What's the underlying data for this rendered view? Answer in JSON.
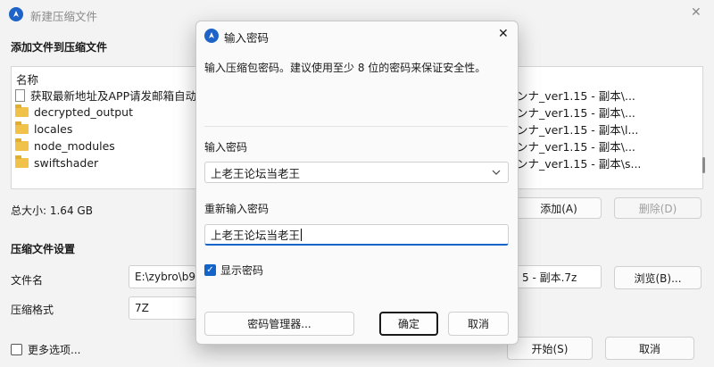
{
  "window": {
    "title": "新建压缩文件",
    "close_glyph": "✕",
    "section_add": "添加文件到压缩文件",
    "list": {
      "header": "名称",
      "items": [
        {
          "name": "获取最新地址及APP请发邮箱自动",
          "type": "file-icon",
          "path": "ンナ_ver1.15 - 副本\\..."
        },
        {
          "name": "decrypted_output",
          "type": "folder-icon",
          "path": "ンナ_ver1.15 - 副本\\..."
        },
        {
          "name": "locales",
          "type": "folder-icon",
          "path": "ンナ_ver1.15 - 副本\\l..."
        },
        {
          "name": "node_modules",
          "type": "folder-icon",
          "path": "ンナ_ver1.15 - 副本\\..."
        },
        {
          "name": "swiftshader",
          "type": "folder-icon",
          "path": "ンナ_ver1.15 - 副本\\s..."
        }
      ]
    },
    "total_size": "总大小: 1.64 GB",
    "add_button": "添加(A)",
    "delete_button": "删除(D)",
    "section_settings": "压缩文件设置",
    "filename_label": "文件名",
    "filename_value_left": "E:\\zybro\\b9.",
    "filename_value_right": "5 - 副本.7z",
    "browse_button": "浏览(B)...",
    "format_label": "压缩格式",
    "format_value": "7Z",
    "more_options": "更多选项...",
    "start_button": "开始(S)",
    "cancel_button": "取消"
  },
  "dialog": {
    "title": "输入密码",
    "close_glyph": "✕",
    "description": "输入压缩包密码。建议使用至少 8 位的密码来保证安全性。",
    "password_label": "输入密码",
    "password_value": "上老王论坛当老王",
    "confirm_label": "重新输入密码",
    "confirm_value": "上老王论坛当老王",
    "show_password": "显示密码",
    "show_password_checked": true,
    "manager_button": "密码管理器...",
    "ok_button": "确定",
    "cancel_button": "取消"
  },
  "colors": {
    "accent": "#1463c8",
    "folder": "#f0c24a"
  }
}
